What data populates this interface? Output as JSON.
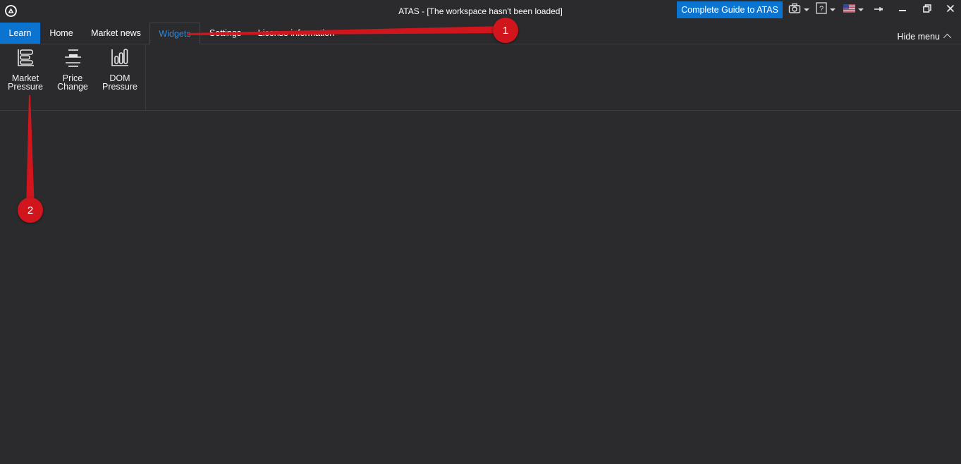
{
  "window": {
    "title": "ATAS - [The workspace hasn't been loaded]",
    "guide_button": "Complete Guide to ATAS"
  },
  "toolbar_icons": [
    "camera-icon",
    "help-icon",
    "us-flag-icon",
    "pin-icon",
    "minimize-icon",
    "restore-icon",
    "close-icon"
  ],
  "tabs": [
    {
      "label": "Learn",
      "state": "highlighted"
    },
    {
      "label": "Home"
    },
    {
      "label": "Market news"
    },
    {
      "label": "Widgets",
      "state": "active"
    },
    {
      "label": "Settings"
    },
    {
      "label": "License information"
    }
  ],
  "hide_menu": "Hide menu",
  "ribbon": {
    "buttons": [
      {
        "label": "Market\nPressure",
        "icon": "market-pressure-icon"
      },
      {
        "label": "Price\nChange",
        "icon": "price-change-icon"
      },
      {
        "label": "DOM\nPressure",
        "icon": "dom-pressure-icon"
      }
    ]
  },
  "annotations": [
    {
      "number": "1",
      "target": "Widgets tab"
    },
    {
      "number": "2",
      "target": "Market Pressure button"
    }
  ],
  "colors": {
    "background": "#2b2b2e",
    "accent": "#0b74d0",
    "active_tab_text": "#2a8ae0",
    "annotation": "#d0161c"
  }
}
